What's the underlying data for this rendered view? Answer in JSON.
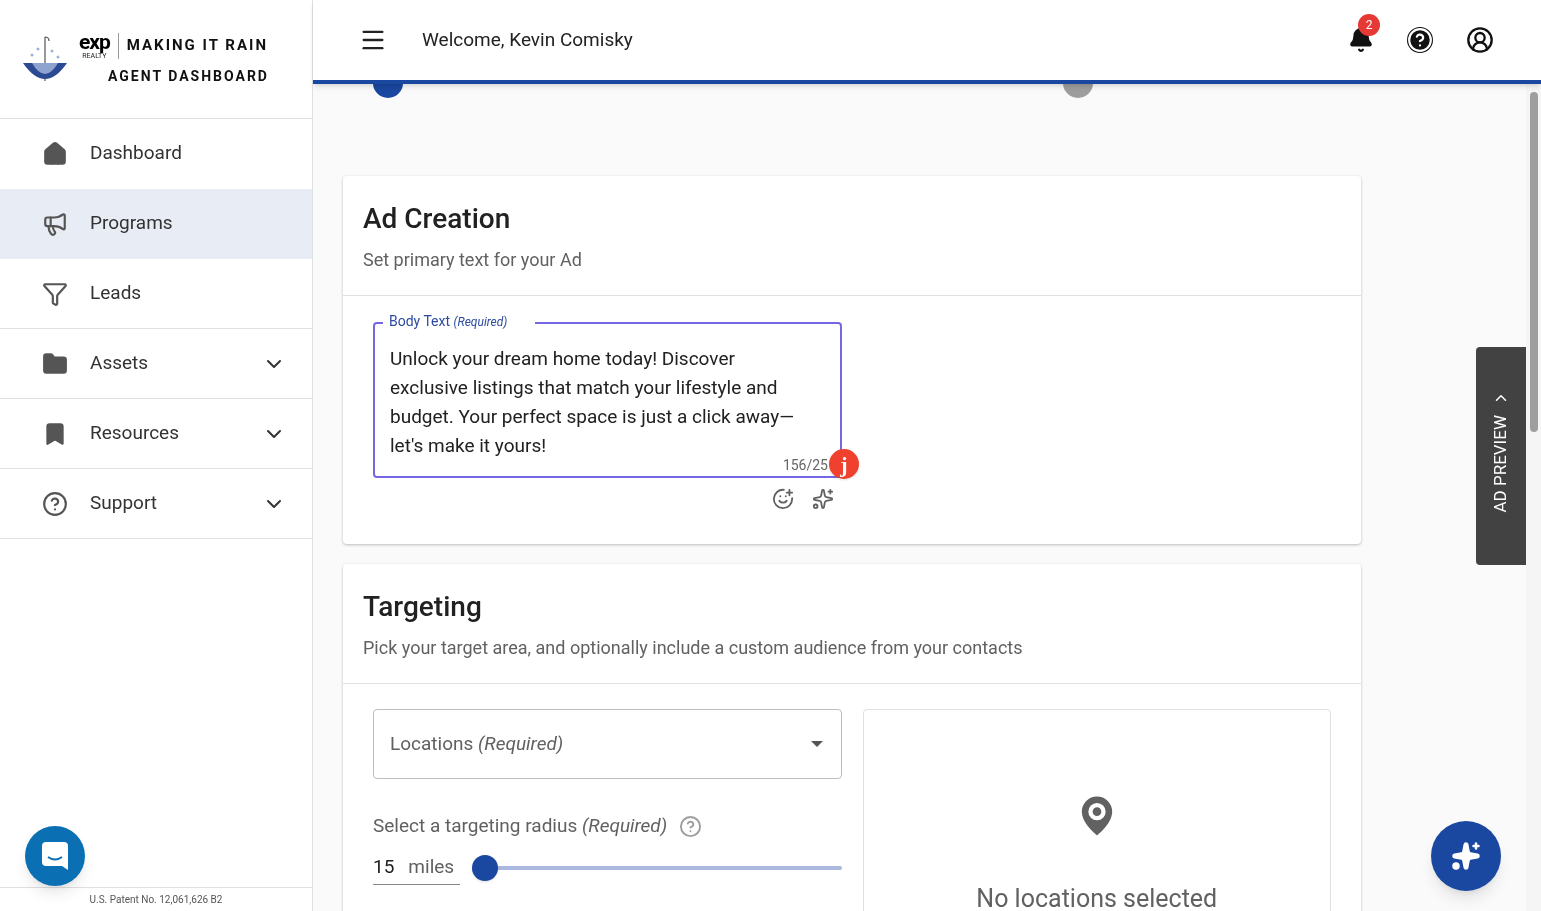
{
  "logo": {
    "brand": "exp",
    "brand_sub": "REALTY",
    "title": "MAKING IT RAIN",
    "subtitle": "AGENT DASHBOARD"
  },
  "sidebar": {
    "items": [
      {
        "label": "Dashboard",
        "selected": false,
        "expandable": false
      },
      {
        "label": "Programs",
        "selected": true,
        "expandable": false
      },
      {
        "label": "Leads",
        "selected": false,
        "expandable": false
      },
      {
        "label": "Assets",
        "selected": false,
        "expandable": true
      },
      {
        "label": "Resources",
        "selected": false,
        "expandable": true
      },
      {
        "label": "Support",
        "selected": false,
        "expandable": true
      }
    ],
    "footer": "U.S. Patent No. 12,061,626 B2"
  },
  "header": {
    "greeting": "Welcome, Kevin Comisky",
    "notification_count": "2"
  },
  "steps": [
    {
      "active": true
    },
    {
      "active": false
    }
  ],
  "ad_creation": {
    "title": "Ad Creation",
    "subtitle": "Set primary text for your Ad",
    "body_field": {
      "label": "Body Text",
      "required": "(Required)",
      "value": "Unlock your dream home today! Discover exclusive listings that match your lifestyle and budget. Your perfect space is just a click away—let's make it yours!",
      "counter": "156/25",
      "assistant_badge": "j"
    }
  },
  "targeting": {
    "title": "Targeting",
    "subtitle": "Pick your target area, and optionally include a custom audience from your contacts",
    "locations": {
      "placeholder": "Locations",
      "required": "(Required)"
    },
    "radius": {
      "label": "Select a targeting radius",
      "required": "(Required)",
      "value": "15",
      "unit": "miles",
      "level": 0
    },
    "map_empty": "No locations selected"
  },
  "ad_preview": {
    "label": "AD PREVIEW"
  }
}
